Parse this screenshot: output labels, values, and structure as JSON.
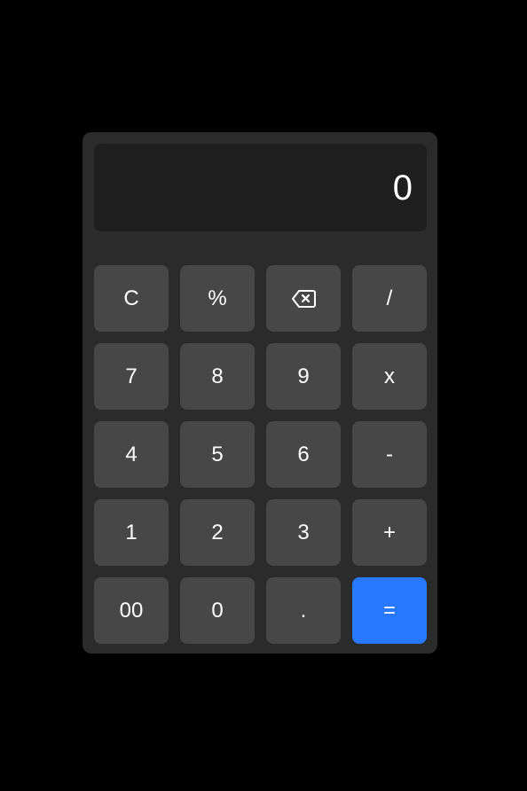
{
  "display": {
    "value": "0"
  },
  "colors": {
    "background": "#000000",
    "panel": "#2b2b2b",
    "display": "#1e1e1e",
    "key": "#474747",
    "accent": "#2979ff"
  },
  "keys": {
    "clear": "C",
    "percent": "%",
    "backspace_icon": "backspace-icon",
    "divide": "/",
    "seven": "7",
    "eight": "8",
    "nine": "9",
    "multiply": "x",
    "four": "4",
    "five": "5",
    "six": "6",
    "subtract": "-",
    "one": "1",
    "two": "2",
    "three": "3",
    "add": "+",
    "double_zero": "00",
    "zero": "0",
    "decimal": ".",
    "equals": "="
  }
}
